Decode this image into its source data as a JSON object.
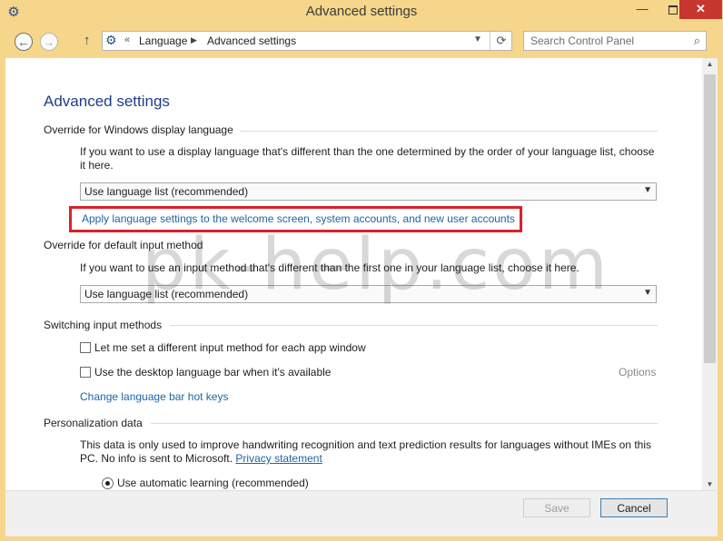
{
  "window": {
    "title": "Advanced settings",
    "minimize_glyph": "—",
    "close_glyph": "✕",
    "icon": "control-panel-icon"
  },
  "nav": {
    "back_glyph": "←",
    "forward_glyph": "→",
    "up_glyph": "↑",
    "chevrons": "«",
    "breadcrumb": [
      "Language",
      "Advanced settings"
    ],
    "search_placeholder": "Search Control Panel"
  },
  "page": {
    "title": "Advanced settings",
    "display_language": {
      "heading": "Override for Windows display language",
      "description": "If you want to use a display language that's different than the one determined by the order of your language list, choose it here.",
      "selected": "Use language list (recommended)",
      "link": "Apply language settings to the welcome screen, system accounts, and new user accounts"
    },
    "input_method": {
      "heading": "Override for default input method",
      "description": "If you want to use an input method that's different than the first one in your language list, choose it here.",
      "selected": "Use language list (recommended)"
    },
    "switching": {
      "heading": "Switching input methods",
      "checkbox_per_app": "Let me set a different input method for each app window",
      "checkbox_desktop_bar": "Use the desktop language bar when it's available",
      "options_link": "Options",
      "hotkeys_link": "Change language bar hot keys"
    },
    "personalization": {
      "heading": "Personalization data",
      "description_part1": "This data is only used to improve handwriting recognition and text prediction results for languages without IMEs on this PC. No info is sent to Microsoft.",
      "privacy_link": "Privacy statement",
      "radio_label": "Use automatic learning (recommended)"
    },
    "watermark": "pk-help.com"
  },
  "footer": {
    "save_label": "Save",
    "cancel_label": "Cancel"
  },
  "colors": {
    "titlebar": "#f5d68a",
    "link": "#1f64a8",
    "title_blue": "#1e3c8c",
    "highlight_red": "#d9212a",
    "close_red": "#c7372f"
  }
}
